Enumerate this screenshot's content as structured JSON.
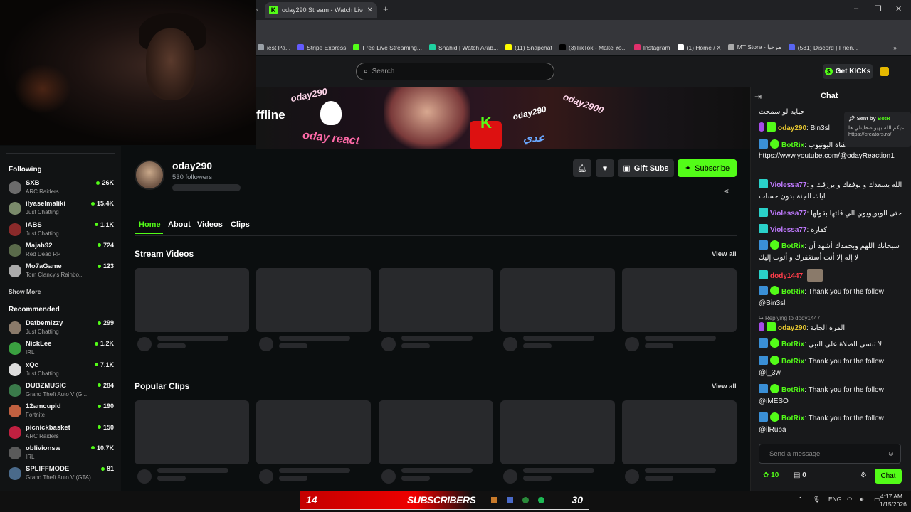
{
  "browser": {
    "tab_title": "oday290 Stream - Watch Live",
    "tab_favicon": "K",
    "new_tab": "+",
    "bookmarks": [
      {
        "label": "iest Pa...",
        "color": "#9aa0a6"
      },
      {
        "label": "Stripe Express",
        "color": "#635bff"
      },
      {
        "label": "Free Live Streaming...",
        "color": "#53fc18"
      },
      {
        "label": "Shahid | Watch Arab...",
        "color": "#1fd1a0"
      },
      {
        "label": "(11) Snapchat",
        "color": "#fffc00"
      },
      {
        "label": "(3)TikTok - Make Yo...",
        "color": "#000000"
      },
      {
        "label": "Instagram",
        "color": "#e1306c"
      },
      {
        "label": "(1) Home / X",
        "color": "#ffffff"
      },
      {
        "label": "MT Store - مرحبا",
        "color": "#aaaaaa"
      },
      {
        "label": "(531) Discord | Frien...",
        "color": "#5865f2"
      }
    ]
  },
  "header": {
    "search_placeholder": "Search",
    "get_kicks": "Get KICKs"
  },
  "banner": {
    "offline_label": "ffline",
    "texts": [
      "oday290",
      "oday290",
      "oday2900",
      "oday react",
      "عدي"
    ]
  },
  "profile": {
    "name": "oday290",
    "followers": "530 followers",
    "gift_subs": "Gift Subs",
    "subscribe": "Subscribe"
  },
  "tabs": [
    "Home",
    "About",
    "Videos",
    "Clips"
  ],
  "sections": {
    "stream_videos": "Stream Videos",
    "popular_clips": "Popular Clips",
    "view_all": "View all"
  },
  "sidebar": {
    "following_title": "Following",
    "following": [
      {
        "name": "SXB",
        "category": "ARC Raiders",
        "viewers": "26K",
        "color": "#6b6b6b"
      },
      {
        "name": "ilyaselmaliki",
        "category": "Just Chatting",
        "viewers": "15.4K",
        "color": "#7a8a6a"
      },
      {
        "name": "iABS",
        "category": "Just Chatting",
        "viewers": "1.1K",
        "color": "#8a2a2a"
      },
      {
        "name": "Majah92",
        "category": "Red Dead RP",
        "viewers": "724",
        "color": "#5a6a4a"
      },
      {
        "name": "Mo7aGame",
        "category": "Tom Clancy's Rainbo...",
        "viewers": "123",
        "color": "#aaaaaa"
      }
    ],
    "show_more": "Show More",
    "recommended_title": "Recommended",
    "recommended": [
      {
        "name": "Datbemizzy",
        "category": "Just Chatting",
        "viewers": "299",
        "color": "#8a7a6a"
      },
      {
        "name": "NickLee",
        "category": "IRL",
        "viewers": "1.2K",
        "color": "#3aa040"
      },
      {
        "name": "xQc",
        "category": "Just Chatting",
        "viewers": "7.1K",
        "color": "#dddddd"
      },
      {
        "name": "DUBZMUSIC",
        "category": "Grand Theft Auto V (G...",
        "viewers": "284",
        "color": "#3a7a4a"
      },
      {
        "name": "12amcupid",
        "category": "Fortnite",
        "viewers": "190",
        "color": "#c06040"
      },
      {
        "name": "picnickbasket",
        "category": "ARC Raiders",
        "viewers": "150",
        "color": "#c02040"
      },
      {
        "name": "oblivionsw",
        "category": "IRL",
        "viewers": "10.7K",
        "color": "#5a5a5a"
      },
      {
        "name": "SPLIFFMODE",
        "category": "Grand Theft Auto V (GTA)",
        "viewers": "81",
        "color": "#4a6a8a"
      }
    ]
  },
  "chat": {
    "title": "Chat",
    "pinned_label": "Sent by",
    "pinned_user": "BotR",
    "pinned_text": "عيكم الله بهيو صفايتلي ها",
    "pinned_link": "https://creators.ra/",
    "messages": [
      {
        "user": "",
        "text": "حبابه لو سمحت",
        "type": "plain"
      },
      {
        "user": "oday290",
        "text": "Bin3sl",
        "type": "oday"
      },
      {
        "user": "BotRix",
        "text": "قناة اليوتيوب",
        "type": "bot"
      },
      {
        "user": "",
        "text": "https://www.youtube.com/@odayReaction1",
        "type": "link"
      },
      {
        "user": "Violessa77",
        "text": "الله يسعدك و يوفقك و يرزقك و اياك الجنة بدون حساب",
        "type": "vio"
      },
      {
        "user": "Violessa77",
        "text": "حتى الويويويوي الي قلتها بقولها",
        "type": "vio"
      },
      {
        "user": "Violessa77",
        "text": "كفارة",
        "type": "vio"
      },
      {
        "user": "BotRix",
        "text": "سبحانك اللهم وبحمدك أشهد أن لا إله إلا أنت أستغفرك و أتوب إليك",
        "type": "bot"
      },
      {
        "user": "dody1447",
        "text": "",
        "type": "dody"
      },
      {
        "user": "BotRix",
        "text": "Thank you for the follow @Bin3sl",
        "type": "bot"
      },
      {
        "user": "",
        "text": "Replying to dody1447:",
        "type": "reply"
      },
      {
        "user": "oday290",
        "text": "المرة الجاية",
        "type": "oday"
      },
      {
        "user": "BotRix",
        "text": "لا تنسى الصلاة على النبي",
        "type": "bot"
      },
      {
        "user": "BotRix",
        "text": "Thank you for the follow @l_3w",
        "type": "bot"
      },
      {
        "user": "BotRix",
        "text": "Thank you for the follow @iMESO",
        "type": "bot"
      },
      {
        "user": "BotRix",
        "text": "Thank you for the follow @ilRuba",
        "type": "bot"
      }
    ],
    "input_placeholder": "Send a message",
    "kicks_count": "10",
    "gift_count": "0",
    "send_label": "Chat"
  },
  "overlay": {
    "subs_left": "14",
    "subs_label": "SUBSCRIBERS",
    "subs_right": "30"
  },
  "taskbar": {
    "lang": "ENG",
    "time": "4:17 AM",
    "date": "1/15/2026"
  }
}
